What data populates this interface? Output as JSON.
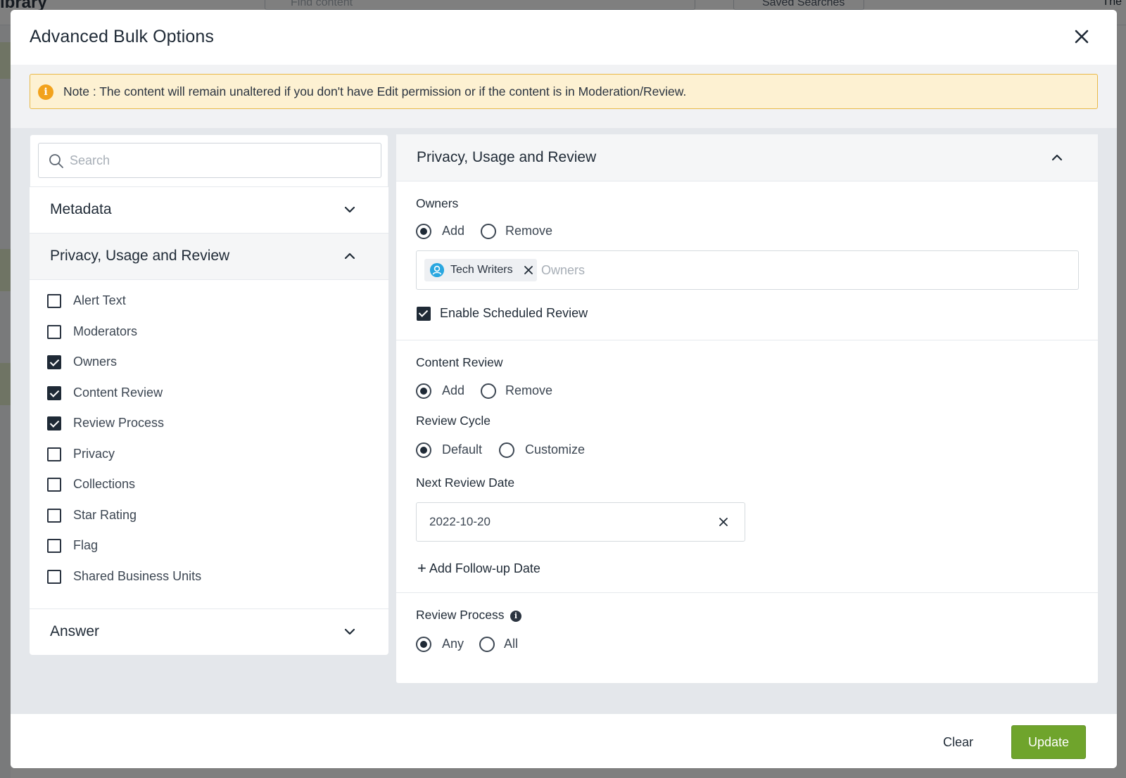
{
  "background": {
    "app_title": "ibrary",
    "search_placeholder": "Find content",
    "saved_searches": "Saved Searches",
    "top_right": "The"
  },
  "modal": {
    "title": "Advanced Bulk Options",
    "close_icon": "close-icon",
    "note": "Note : The content will remain unaltered if you don't have Edit permission or if the content is in Moderation/Review.",
    "note_icon": "info-warning-icon"
  },
  "left_panel": {
    "search_placeholder": "Search",
    "sections": [
      {
        "label": "Metadata",
        "expanded": false
      },
      {
        "label": "Privacy, Usage and Review",
        "expanded": true
      },
      {
        "label": "Answer",
        "expanded": false
      }
    ],
    "privacy_items": [
      {
        "label": "Alert Text",
        "checked": false
      },
      {
        "label": "Moderators",
        "checked": false
      },
      {
        "label": "Owners",
        "checked": true
      },
      {
        "label": "Content Review",
        "checked": true
      },
      {
        "label": "Review Process",
        "checked": true
      },
      {
        "label": "Privacy",
        "checked": false
      },
      {
        "label": "Collections",
        "checked": false
      },
      {
        "label": "Star Rating",
        "checked": false
      },
      {
        "label": "Flag",
        "checked": false
      },
      {
        "label": "Shared Business Units",
        "checked": false
      }
    ]
  },
  "right_panel": {
    "title": "Privacy, Usage and Review",
    "owners": {
      "label": "Owners",
      "options": [
        "Add",
        "Remove"
      ],
      "selected": "Add",
      "chip": "Tech Writers",
      "input_placeholder": "Owners"
    },
    "enable_scheduled_review": {
      "label": "Enable Scheduled Review",
      "checked": true
    },
    "content_review": {
      "label": "Content Review",
      "options": [
        "Add",
        "Remove"
      ],
      "selected": "Add"
    },
    "review_cycle": {
      "label": "Review Cycle",
      "options": [
        "Default",
        "Customize"
      ],
      "selected": "Default"
    },
    "next_review_date": {
      "label": "Next Review Date",
      "value": "2022-10-20"
    },
    "add_followup": "Add Follow-up Date",
    "review_process": {
      "label": "Review Process",
      "options": [
        "Any",
        "All"
      ],
      "selected": "Any"
    }
  },
  "footer": {
    "clear_label": "Clear",
    "update_label": "Update",
    "update_color": "#6fa42c"
  }
}
